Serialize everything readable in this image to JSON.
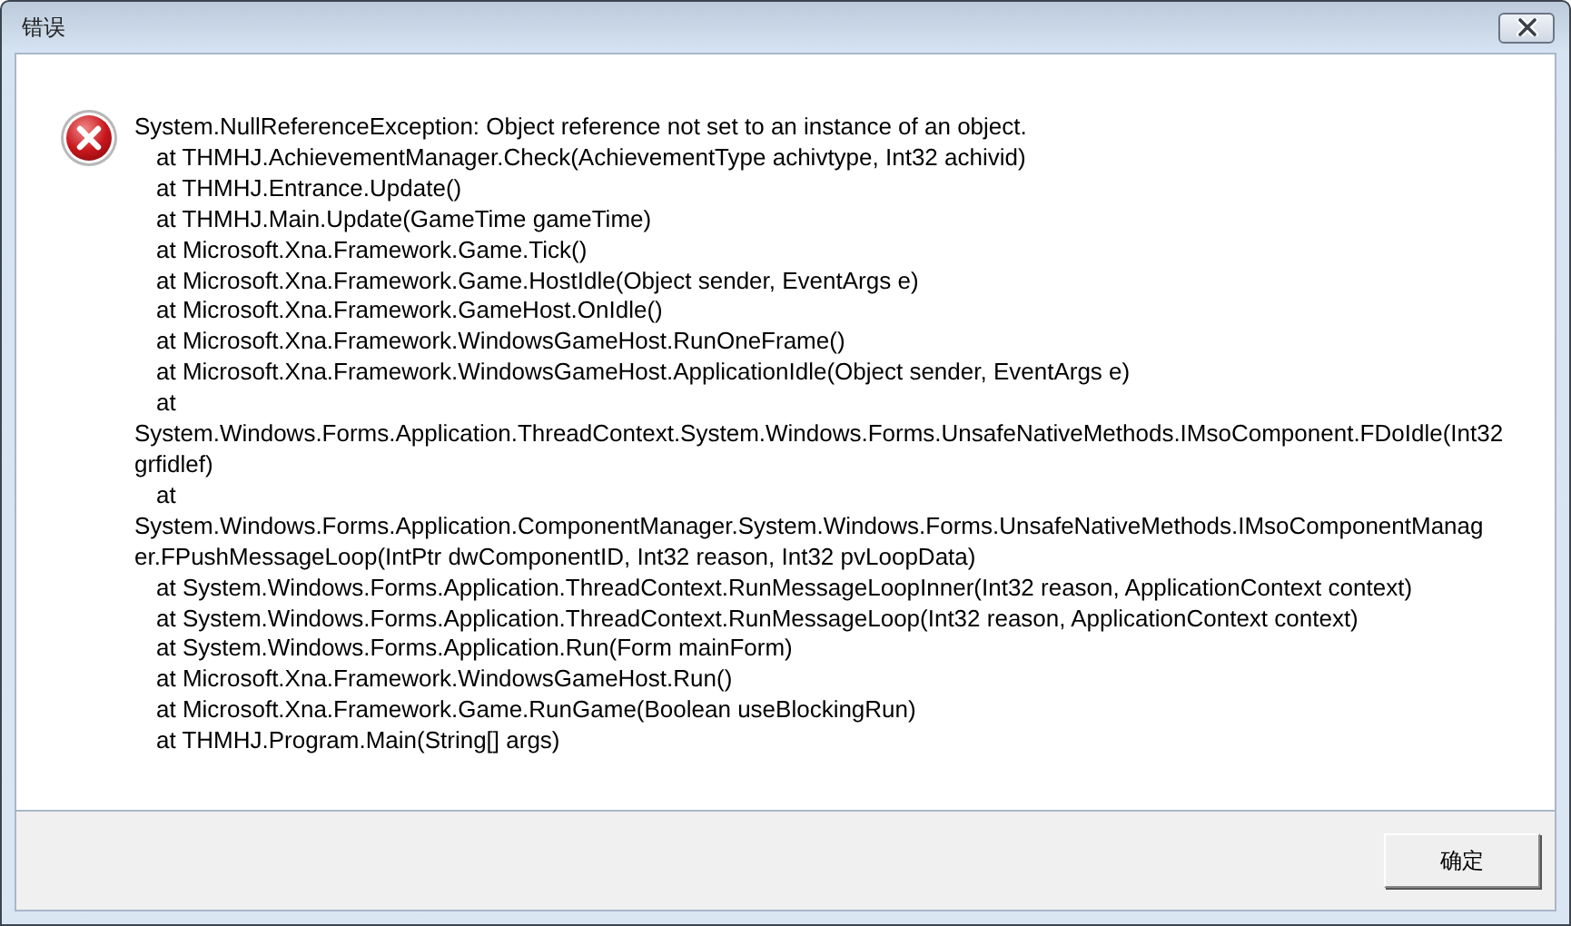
{
  "window": {
    "title": "错误"
  },
  "message": {
    "lines": [
      {
        "text": "System.NullReferenceException: Object reference not set to an instance of an object.",
        "indented": false
      },
      {
        "text": "at THMHJ.AchievementManager.Check(AchievementType achivtype, Int32 achivid)",
        "indented": true
      },
      {
        "text": "at THMHJ.Entrance.Update()",
        "indented": true
      },
      {
        "text": "at THMHJ.Main.Update(GameTime gameTime)",
        "indented": true
      },
      {
        "text": "at Microsoft.Xna.Framework.Game.Tick()",
        "indented": true
      },
      {
        "text": "at Microsoft.Xna.Framework.Game.HostIdle(Object sender, EventArgs e)",
        "indented": true
      },
      {
        "text": "at Microsoft.Xna.Framework.GameHost.OnIdle()",
        "indented": true
      },
      {
        "text": "at Microsoft.Xna.Framework.WindowsGameHost.RunOneFrame()",
        "indented": true
      },
      {
        "text": "at Microsoft.Xna.Framework.WindowsGameHost.ApplicationIdle(Object sender, EventArgs e)",
        "indented": true
      },
      {
        "text": "at",
        "indented": true
      },
      {
        "text": "System.Windows.Forms.Application.ThreadContext.System.Windows.Forms.UnsafeNativeMethods.IMsoComponent.FDoIdle(Int32",
        "indented": false
      },
      {
        "text": "grfidlef)",
        "indented": false
      },
      {
        "text": "at",
        "indented": true
      },
      {
        "text": "System.Windows.Forms.Application.ComponentManager.System.Windows.Forms.UnsafeNativeMethods.IMsoComponentManag",
        "indented": false
      },
      {
        "text": "er.FPushMessageLoop(IntPtr dwComponentID, Int32 reason, Int32 pvLoopData)",
        "indented": false
      },
      {
        "text": "at System.Windows.Forms.Application.ThreadContext.RunMessageLoopInner(Int32 reason, ApplicationContext context)",
        "indented": true
      },
      {
        "text": "at System.Windows.Forms.Application.ThreadContext.RunMessageLoop(Int32 reason, ApplicationContext context)",
        "indented": true
      },
      {
        "text": "at System.Windows.Forms.Application.Run(Form mainForm)",
        "indented": true
      },
      {
        "text": "at Microsoft.Xna.Framework.WindowsGameHost.Run()",
        "indented": true
      },
      {
        "text": "at Microsoft.Xna.Framework.Game.RunGame(Boolean useBlockingRun)",
        "indented": true
      },
      {
        "text": "at THMHJ.Program.Main(String[] args)",
        "indented": true
      }
    ]
  },
  "buttons": [
    {
      "label": "确定"
    }
  ]
}
